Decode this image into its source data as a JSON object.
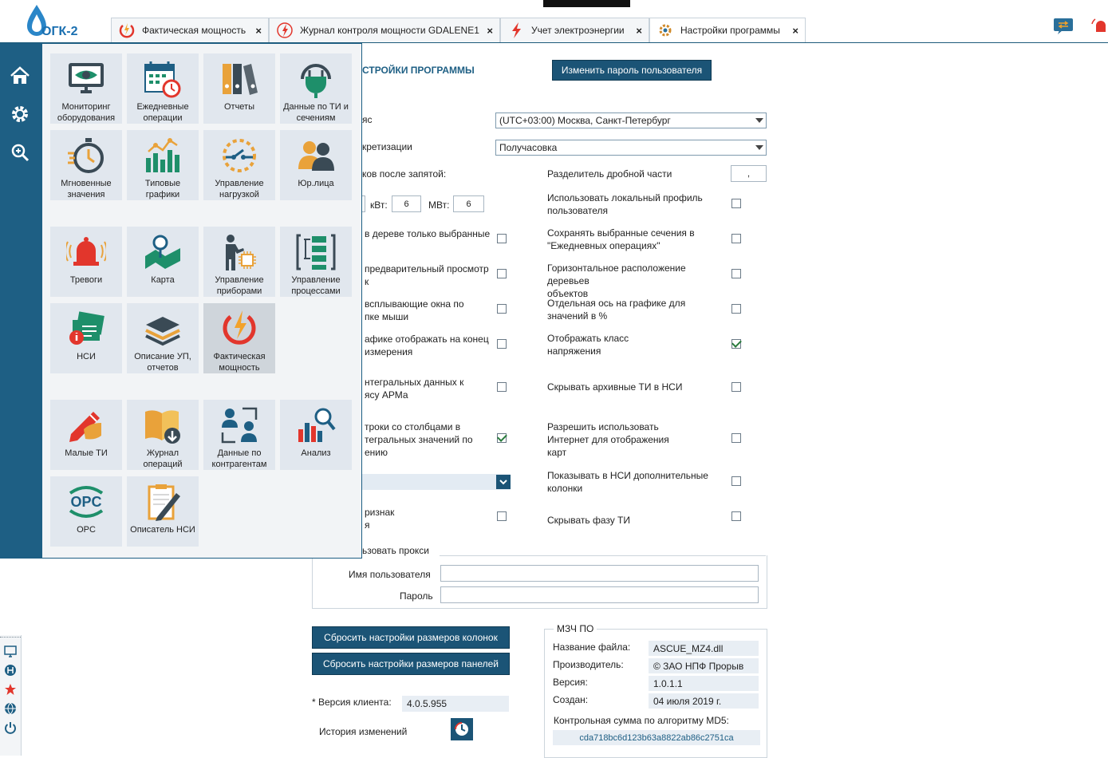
{
  "logo": {
    "text": "ОГК-2"
  },
  "tabs": [
    {
      "label": "Фактическая мощность",
      "icon": "power-bolt-icon"
    },
    {
      "label": "Журнал контроля мощности GDALENE1",
      "icon": "power-bolt-icon"
    },
    {
      "label": "Учет электроэнергии",
      "icon": "bolt-icon"
    },
    {
      "label": "Настройки программы",
      "icon": "settings-tools-icon"
    }
  ],
  "tab_close": "×",
  "sidebar": [
    {
      "icon": "home-icon"
    },
    {
      "icon": "gear-icon"
    },
    {
      "icon": "zoom-icon"
    }
  ],
  "menu": {
    "tiles": [
      {
        "label": "Мониторинг оборудования",
        "icon": "monitor-eye-icon"
      },
      {
        "label": "Ежедневные операции",
        "icon": "calendar-clock-icon"
      },
      {
        "label": "Отчеты",
        "icon": "binders-icon"
      },
      {
        "label": "Данные по ТИ и сечениям",
        "icon": "plug-icon"
      },
      {
        "label": "Мгновенные значения",
        "icon": "stopwatch-icon"
      },
      {
        "label": "Типовые графики",
        "icon": "bar-chart-icon"
      },
      {
        "label": "Управление нагрузкой",
        "icon": "switch-icon"
      },
      {
        "label": "Юр.лица",
        "icon": "people-icon"
      },
      {
        "label": "Тревоги",
        "icon": "alarm-bell-icon"
      },
      {
        "label": "Карта",
        "icon": "map-icon"
      },
      {
        "label": "Управление приборами",
        "icon": "presenter-chip-icon"
      },
      {
        "label": "Управление процессами",
        "icon": "process-icon"
      },
      {
        "label": "НСИ",
        "icon": "info-card-icon"
      },
      {
        "label": "Описание УП, отчетов",
        "icon": "layers-icon"
      },
      {
        "label": "Фактическая мощность",
        "icon": "power-bolt-icon"
      },
      {
        "label": "Малые ТИ",
        "icon": "pencil-hand-icon"
      },
      {
        "label": "Журнал операций",
        "icon": "book-download-icon"
      },
      {
        "label": "Данные по контрагентам",
        "icon": "contacts-icon"
      },
      {
        "label": "Анализ",
        "icon": "analysis-icon"
      },
      {
        "label": "OPC",
        "icon": "opc-icon"
      },
      {
        "label": "Описатель НСИ",
        "icon": "clipboard-pen-icon"
      }
    ]
  },
  "settings": {
    "title": "СТРОЙКИ ПРОГРАММЫ",
    "change_password_button": "Изменить пароль пользователя",
    "timezone_label": "яс",
    "timezone_value": "(UTC+03:00) Москва, Санкт-Петербург",
    "discretization_label": "кретизации",
    "discretization_value": "Получасовка",
    "decimals_label": "ков после запятой:",
    "decimal_separator_label": "Разделитель дробной части",
    "decimal_separator_value": ",",
    "kw_label": "кВт:",
    "kw_value": "6",
    "mw_label": "МВт:",
    "mw_value": "6",
    "left_options": [
      {
        "text": "в дереве только выбранные",
        "checked": false
      },
      {
        "text": "предварительный просмотр\nк",
        "checked": false
      },
      {
        "text": "всплывающие окна по\nпке мыши",
        "checked": false
      },
      {
        "text": "афике отображать на конец\nизмерения",
        "checked": false
      },
      {
        "text": "нтегральных данных к\nясу АРМа",
        "checked": false
      },
      {
        "text": "троки со столбцами в\nтегральных значений по\nению",
        "checked": true
      },
      {
        "text": "ризнак\nя",
        "checked": false
      }
    ],
    "left_dropdown_value": "",
    "right_options": [
      {
        "text": "Использовать локальный профиль\nпользователя",
        "checked": false
      },
      {
        "text": "Сохранять выбранные сечения в\n\"Ежедневных операциях\"",
        "checked": false
      },
      {
        "text": "Горизонтальное расположение деревьев\nобъектов",
        "checked": false
      },
      {
        "text": "Отдельная ось на графике для\nзначений в %",
        "checked": false
      },
      {
        "text": "Отображать класс\nнапряжения",
        "checked": true
      },
      {
        "text": "Скрывать архивные ТИ в НСИ",
        "checked": false
      },
      {
        "text": "Разрешить использовать\nИнтернет для отображения\nкарт",
        "checked": false
      },
      {
        "text": "Показывать в НСИ дополнительные\nколонки",
        "checked": false
      },
      {
        "text": "Скрывать фазу ТИ",
        "checked": false
      }
    ],
    "proxy": {
      "legend": "ьзовать прокси",
      "username_label": "Имя пользователя",
      "username_value": "",
      "password_label": "Пароль",
      "password_value": ""
    },
    "reset_columns_button": "Сбросить настройки размеров колонок",
    "reset_panels_button": "Сбросить настройки размеров панелей",
    "client_version_label": "* Версия клиента:",
    "client_version_value": "4.0.5.955",
    "history_label": "История изменений",
    "mz": {
      "legend": "МЗЧ ПО",
      "file_label": "Название файла:",
      "file_value": "ASCUE_MZ4.dll",
      "vendor_label": "Производитель:",
      "vendor_value": "© ЗАО НПФ Прорыв",
      "version_label": "Версия:",
      "version_value": "1.0.1.1",
      "created_label": "Создан:",
      "created_value": "04 июля 2019 г.",
      "md5_label": "Контрольная сумма по алгоритму MD5:",
      "md5_value": "cda718bc6d123b63a8822ab86c2751ca"
    }
  },
  "colors": {
    "sidebar": "#1e5f84",
    "button": "#1b5476",
    "tile": "#e1e7ee",
    "accent_red": "#e2362c"
  }
}
